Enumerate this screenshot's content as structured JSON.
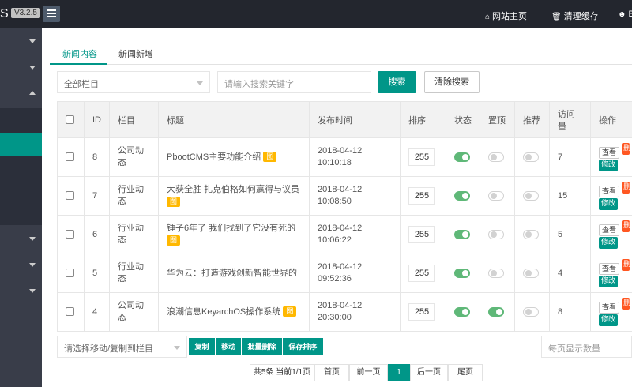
{
  "header": {
    "brand": "S",
    "version": "V3.2.5",
    "links": [
      {
        "icon": "home-icon",
        "label": "网站主页"
      },
      {
        "icon": "trash-icon",
        "label": "清理缓存"
      },
      {
        "icon": "user-icon",
        "label": "B"
      }
    ]
  },
  "tabs": [
    {
      "label": "新闻内容",
      "active": true
    },
    {
      "label": "新闻新增",
      "active": false
    }
  ],
  "search": {
    "category_select": "全部栏目",
    "keyword_placeholder": "请输入搜索关键字",
    "search_button": "搜索",
    "clear_button": "清除搜索"
  },
  "table": {
    "columns": [
      "",
      "ID",
      "栏目",
      "标题",
      "发布时间",
      "排序",
      "状态",
      "置顶",
      "推荐",
      "访问量",
      "操作"
    ],
    "rows": [
      {
        "id": "8",
        "category": "公司动态",
        "title": "PbootCMS主要功能介绍",
        "has_image": true,
        "date": "2018-04-12",
        "time": "10:10:18",
        "sort": "255",
        "status": true,
        "top": false,
        "recommend": false,
        "visits": "7"
      },
      {
        "id": "7",
        "category": "行业动态",
        "title": "大获全胜 扎克伯格如何赢得与议员",
        "has_image": true,
        "date": "2018-04-12",
        "time": "10:08:50",
        "sort": "255",
        "status": true,
        "top": false,
        "recommend": false,
        "visits": "15"
      },
      {
        "id": "6",
        "category": "行业动态",
        "title": "锤子6年了 我们找到了它没有死的",
        "has_image": true,
        "date": "2018-04-12",
        "time": "10:06:22",
        "sort": "255",
        "status": true,
        "top": false,
        "recommend": false,
        "visits": "5"
      },
      {
        "id": "5",
        "category": "行业动态",
        "title": "华为云：打造游戏创新智能世界的",
        "has_image": false,
        "date": "2018-04-12",
        "time": "09:52:36",
        "sort": "255",
        "status": true,
        "top": false,
        "recommend": false,
        "visits": "4"
      },
      {
        "id": "4",
        "category": "公司动态",
        "title": "浪潮信息KeyarchOS操作系统",
        "has_image": true,
        "date": "2018-04-12",
        "time": "20:30:00",
        "sort": "255",
        "status": true,
        "top": true,
        "recommend": false,
        "visits": "8"
      }
    ],
    "image_badge": "图",
    "ops": {
      "view": "查看",
      "delete": "删除",
      "edit": "修改"
    }
  },
  "bulk": {
    "move_select": "请选择移动/复制到栏目",
    "copy": "复制",
    "move": "移动",
    "batch_delete": "批量删除",
    "save_sort": "保存排序",
    "page_size_placeholder": "每页显示数量"
  },
  "pagination": {
    "summary": "共5条 当前1/1页",
    "first": "首页",
    "prev": "前一页",
    "current": "1",
    "next": "后一页",
    "last": "尾页"
  },
  "colors": {
    "accent": "#009688",
    "header_bg": "#23262e",
    "sidebar_bg": "#393d49",
    "toggle_on": "#5fb878",
    "image_badge": "#ffb800",
    "delete": "#ff5722"
  }
}
